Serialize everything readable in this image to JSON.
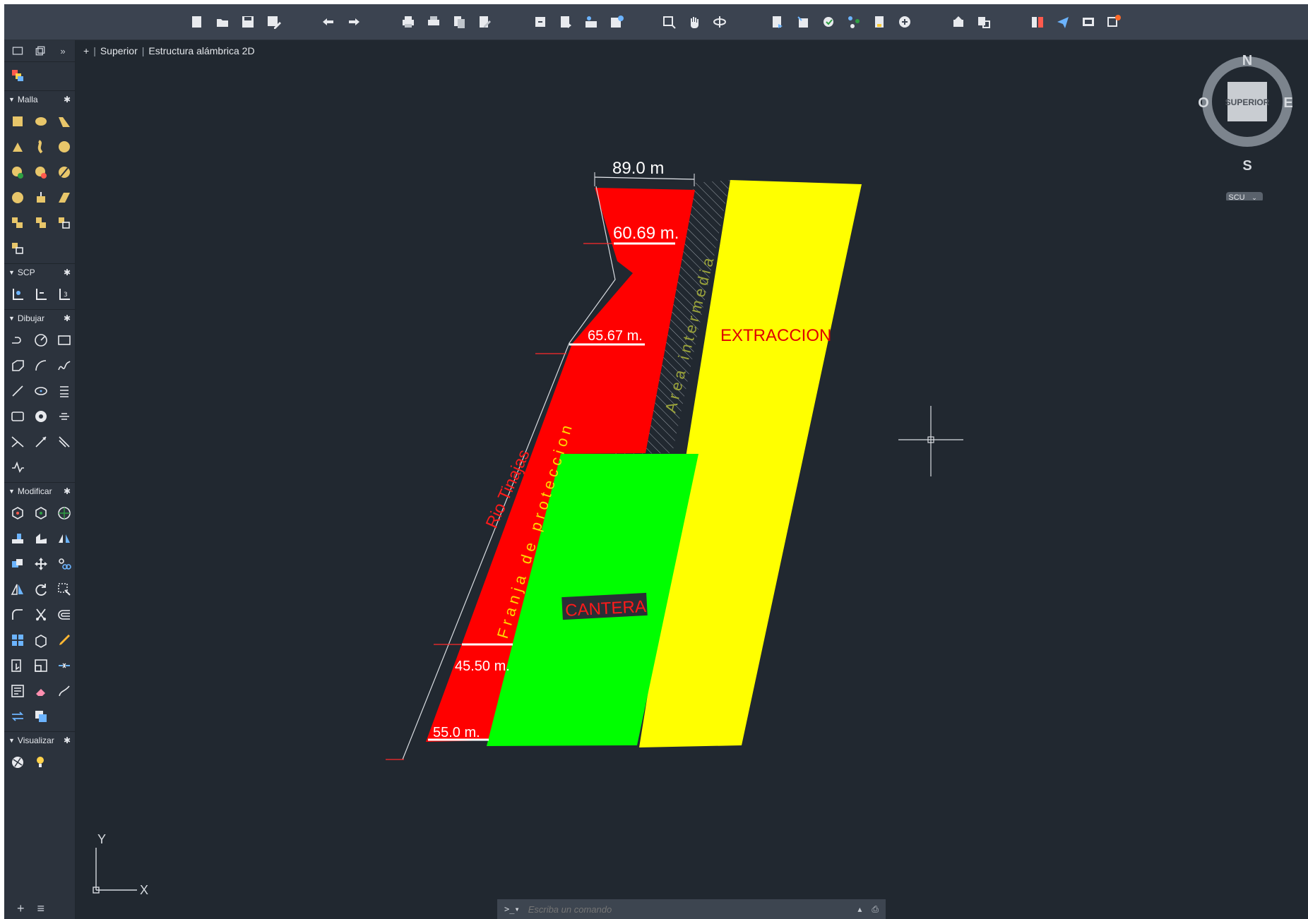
{
  "viewport": {
    "plus": "+",
    "view": "Superior",
    "visual_style": "Estructura alámbrica 2D"
  },
  "viewcube": {
    "north": "N",
    "south": "S",
    "east": "E",
    "west": "O",
    "face": "SUPERIOR",
    "ucs_menu": "SCU"
  },
  "palette": {
    "sections": {
      "malla": "Malla",
      "scp": "SCP",
      "dibujar": "Dibujar",
      "modificar": "Modificar",
      "visualizar": "Visualizar"
    },
    "more": "»"
  },
  "drawing": {
    "dim_top": "89.0 m",
    "dim_1": "60.69 m.",
    "dim_2": "65.67 m.",
    "dim_3": "45.50 m.",
    "dim_4": "55.0 m.",
    "label_extraccion": "EXTRACCION",
    "label_cantera": "CANTERA",
    "label_rio": "Rio Tinajas",
    "label_franja": "Franja de proteccion",
    "label_area": "Area intermedia",
    "colors": {
      "strip": "#ff0000",
      "quarry": "#00ff00",
      "extraction": "#ffff00",
      "background": "#212830"
    }
  },
  "ucs": {
    "x": "X",
    "y": "Y"
  },
  "command": {
    "prompt": ">_▾",
    "placeholder": "Escriba un comando"
  }
}
